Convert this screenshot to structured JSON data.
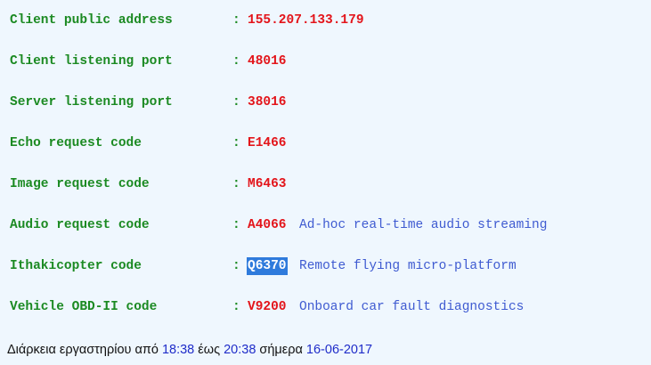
{
  "rows": [
    {
      "label": "Client public address",
      "colon": ":",
      "value": "155.207.133.179"
    },
    {
      "label": "Client listening port",
      "colon": ":",
      "value": "48016"
    },
    {
      "label": "Server listening port",
      "colon": ":",
      "value": "38016"
    },
    {
      "label": "Echo request code",
      "colon": ":",
      "value": "E1466"
    },
    {
      "label": "Image request code",
      "colon": ":",
      "value": "M6463"
    },
    {
      "label": "Audio request code",
      "colon": ":",
      "value": "A4066",
      "description": "Ad-hoc real-time audio streaming"
    },
    {
      "label": "Ithakicopter code",
      "colon": ":",
      "value": "Q6370",
      "description": "Remote flying micro-platform",
      "selected": true
    },
    {
      "label": "Vehicle OBD-II code",
      "colon": ":",
      "value": "V9200",
      "description": "Onboard car fault diagnostics"
    }
  ],
  "footer": {
    "prefix": "Διάρκεια εργαστηρίου από",
    "start_time": "18:38",
    "until": "έως",
    "end_time": "20:38",
    "today": "σήμερα",
    "date": "16-06-2017"
  },
  "colors": {
    "background": "#eff7fe",
    "label": "#1b8a22",
    "value": "#e3151b",
    "description": "#3f5bd1",
    "footer_highlight": "#1f2cc9",
    "selection": "#2f7bdc"
  }
}
